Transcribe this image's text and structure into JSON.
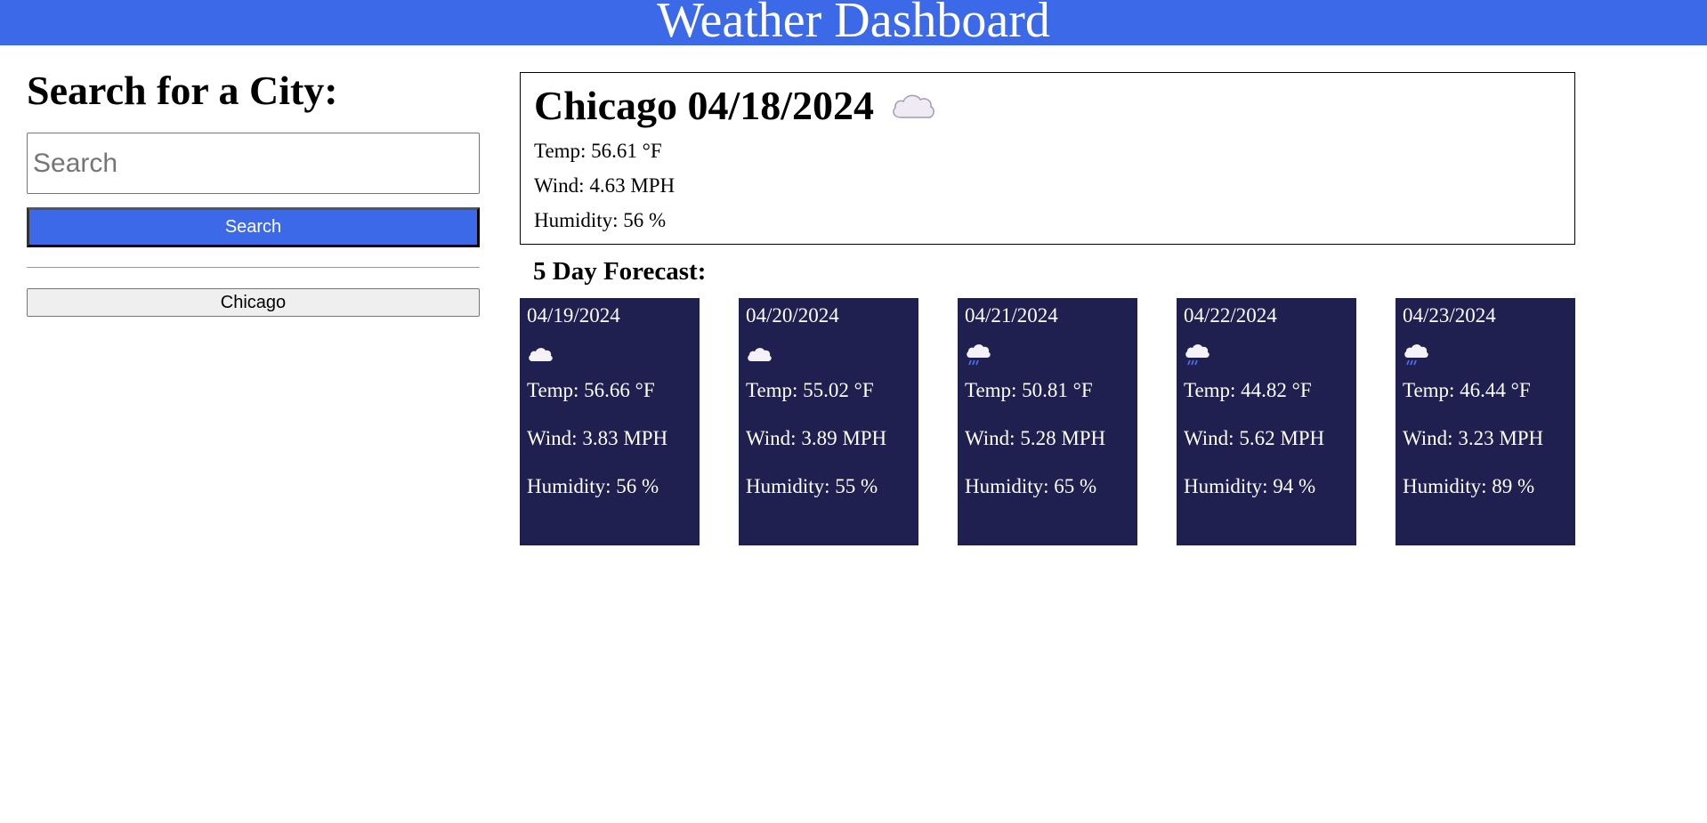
{
  "header": {
    "title": "Weather Dashboard"
  },
  "sidebar": {
    "heading": "Search for a City:",
    "search_placeholder": "Search",
    "search_value": "",
    "search_button_label": "Search",
    "history": [
      "Chicago"
    ]
  },
  "current": {
    "title": "Chicago 04/18/2024",
    "icon": "cloud-icon",
    "temp": "Temp: 56.61 °F",
    "wind": "Wind: 4.63 MPH",
    "humidity": "Humidity: 56 %"
  },
  "forecast": {
    "heading": "5 Day Forecast:",
    "days": [
      {
        "date": "04/19/2024",
        "icon": "cloud-icon",
        "temp": "Temp: 56.66 °F",
        "wind": "Wind: 3.83 MPH",
        "humidity": "Humidity: 56 %"
      },
      {
        "date": "04/20/2024",
        "icon": "cloud-icon",
        "temp": "Temp: 55.02 °F",
        "wind": "Wind: 3.89 MPH",
        "humidity": "Humidity: 55 %"
      },
      {
        "date": "04/21/2024",
        "icon": "rain-cloud-icon",
        "temp": "Temp: 50.81 °F",
        "wind": "Wind: 5.28 MPH",
        "humidity": "Humidity: 65 %"
      },
      {
        "date": "04/22/2024",
        "icon": "rain-cloud-icon",
        "temp": "Temp: 44.82 °F",
        "wind": "Wind: 5.62 MPH",
        "humidity": "Humidity: 94 %"
      },
      {
        "date": "04/23/2024",
        "icon": "rain-cloud-icon",
        "temp": "Temp: 46.44 °F",
        "wind": "Wind: 3.23 MPH",
        "humidity": "Humidity: 89 %"
      }
    ]
  },
  "colors": {
    "header_bg": "#3c69e7",
    "card_bg": "#1f1f50",
    "rain_blue": "#4a6cf0"
  }
}
